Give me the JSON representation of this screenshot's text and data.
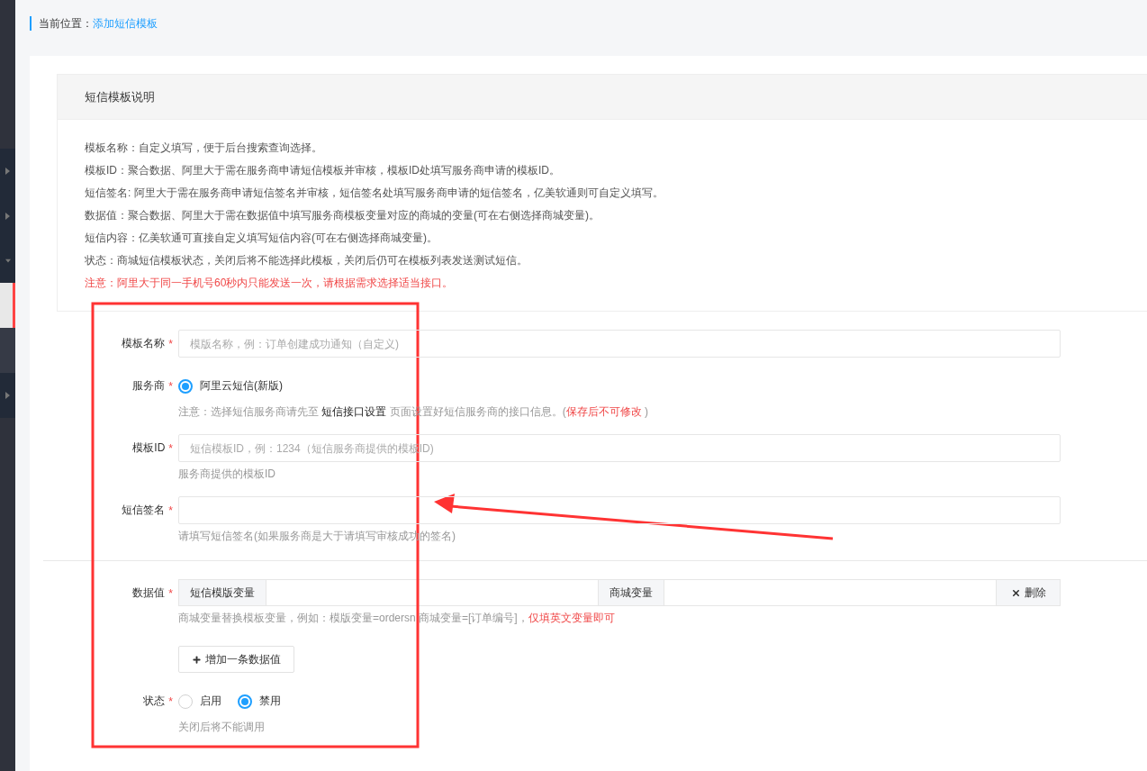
{
  "sidebar": {
    "items": [
      {
        "kind": "group",
        "expanded": false,
        "selected": false
      },
      {
        "kind": "group",
        "expanded": false,
        "selected": false
      },
      {
        "kind": "group",
        "expanded": true,
        "selected": false
      },
      {
        "kind": "sub",
        "selected": true
      },
      {
        "kind": "sub",
        "selected": false
      },
      {
        "kind": "group",
        "expanded": false,
        "selected": false
      }
    ]
  },
  "breadcrumb": {
    "label": "当前位置：",
    "current": "添加短信模板"
  },
  "info": {
    "title": "短信模板说明",
    "lines": [
      {
        "text": "模板名称：自定义填写，便于后台搜索查询选择。",
        "warning": false
      },
      {
        "text": "模板ID：聚合数据、阿里大于需在服务商申请短信模板并审核，模板ID处填写服务商申请的模板ID。",
        "warning": false
      },
      {
        "text": "短信签名: 阿里大于需在服务商申请短信签名并审核，短信签名处填写服务商申请的短信签名，亿美软通则可自定义填写。",
        "warning": false
      },
      {
        "text": "数据值：聚合数据、阿里大于需在数据值中填写服务商模板变量对应的商城的变量(可在右侧选择商城变量)。",
        "warning": false
      },
      {
        "text": "短信内容：亿美软通可直接自定义填写短信内容(可在右侧选择商城变量)。",
        "warning": false
      },
      {
        "text": "状态：商城短信模板状态，关闭后将不能选择此模板，关闭后仍可在模板列表发送测试短信。",
        "warning": false
      },
      {
        "text": "注意：阿里大于同一手机号60秒内只能发送一次，请根据需求选择适当接口。",
        "warning": true
      }
    ]
  },
  "form": {
    "sections": [
      {
        "fields": [
          {
            "kind": "text",
            "label": "模板名称",
            "mark": "*",
            "placeholder": "模版名称，例：订单创建成功通知（自定义)"
          },
          {
            "kind": "radio",
            "label": "服务商",
            "mark": "*",
            "options": [
              {
                "label": "阿里云短信(新版)",
                "selected": true
              }
            ],
            "hint_parts": [
              {
                "text": "注意：选择短信服务商请先至 ",
                "strong": false,
                "warning": false
              },
              {
                "text": "短信接口设置",
                "strong": true,
                "warning": false
              },
              {
                "text": " 页面设置好短信服务商的接口信息。(",
                "strong": false,
                "warning": false
              },
              {
                "text": "保存后不可修改",
                "strong": false,
                "warning": true
              },
              {
                "text": " )",
                "strong": false,
                "warning": false
              }
            ]
          },
          {
            "kind": "text",
            "label": "模板ID",
            "mark": "*",
            "placeholder": "短信模板ID，例：1234（短信服务商提供的模板ID)",
            "hint_parts": [
              {
                "text": "服务商提供的模板ID",
                "strong": false,
                "warning": false
              }
            ]
          },
          {
            "kind": "text",
            "label": "短信签名",
            "mark": "*",
            "hint_parts": [
              {
                "text": "请填写短信签名(如果服务商是大于请填写审核成功的签名)",
                "strong": false,
                "warning": false
              }
            ]
          }
        ]
      },
      {
        "fields": [
          {
            "kind": "pairs",
            "label": "数据值",
            "mark": "*",
            "rows": [
              {
                "template_label": "短信模版变量",
                "mall_label": "商城变量",
                "delete_label": "删除"
              }
            ],
            "hint_parts": [
              {
                "text": "商城变量替换模板变量，例如：模版变量=ordersn 商城变量=[订单编号]，",
                "strong": false,
                "warning": false
              },
              {
                "text": "仅填英文变量即可",
                "strong": false,
                "warning": true
              }
            ],
            "add_button": "增加一条数据值"
          },
          {
            "kind": "radio",
            "label": "状态",
            "mark": "*",
            "options": [
              {
                "label": "启用",
                "selected": false
              },
              {
                "label": "禁用",
                "selected": true
              }
            ],
            "hint_parts": [
              {
                "text": "关闭后将不能调用",
                "strong": false,
                "warning": false
              }
            ]
          }
        ]
      }
    ]
  }
}
